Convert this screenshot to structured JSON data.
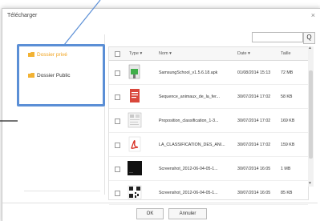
{
  "dialog": {
    "title": "Télécharger",
    "close_glyph": "×"
  },
  "folders": [
    {
      "label": "Dossier privé",
      "selected": true,
      "color": "#f0a11a"
    },
    {
      "label": "Dossier Public",
      "selected": false,
      "color": "#333333"
    }
  ],
  "search": {
    "value": "",
    "button_glyph": "Q"
  },
  "table": {
    "columns": {
      "type": "Type ▾",
      "name": "Nom ▾",
      "date": "Date ▾",
      "size": "Taille"
    },
    "rows": [
      {
        "icon": "apk-file-icon",
        "name": "SamsungSchool_v1.5.6.18.apk",
        "date": "01/08/2014 15:13",
        "size": "72 MB"
      },
      {
        "icon": "document-file-icon",
        "name": "Sequence_animaux_de_la_fer...",
        "date": "30/07/2014 17:02",
        "size": "58 KB"
      },
      {
        "icon": "image-file-icon",
        "name": "Proposition_classification_1-3...",
        "date": "30/07/2014 17:02",
        "size": "169 KB"
      },
      {
        "icon": "pdf-file-icon",
        "name": "LA_CLASSIFICATION_DES_ANI...",
        "date": "30/07/2014 17:02",
        "size": "159 KB"
      },
      {
        "icon": "screenshot-file-icon",
        "name": "Screenshot_2012-06-04-05-1...",
        "date": "30/07/2014 16:05",
        "size": "1 MB"
      },
      {
        "icon": "qrcode-file-icon",
        "name": "Screenshot_2012-06-04-05-1...",
        "date": "30/07/2014 16:05",
        "size": "85 KB"
      }
    ]
  },
  "buttons": {
    "ok": "OK",
    "cancel": "Annuler"
  },
  "colors": {
    "accent": "#f0a11a",
    "highlight": "#5b8fd6"
  }
}
